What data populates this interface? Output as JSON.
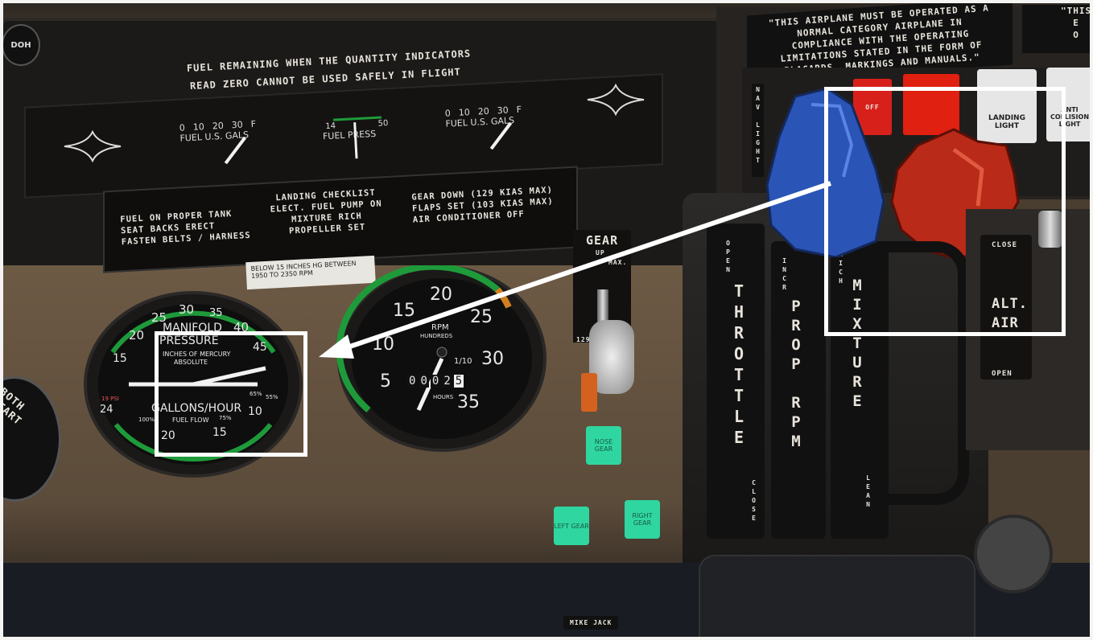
{
  "placard_fuel_remaining": {
    "line1": "FUEL REMAINING WHEN THE QUANTITY INDICATORS",
    "line2": "READ ZERO CANNOT BE USED SAFELY IN FLIGHT"
  },
  "fuel_gauge_left": {
    "label": "FUEL U.S. GALS",
    "ticks": [
      "0",
      "10",
      "20",
      "30",
      "F"
    ]
  },
  "fuel_press_gauge": {
    "label": "FUEL PRESS",
    "ticks": [
      "14",
      "50"
    ]
  },
  "fuel_gauge_right": {
    "label": "FUEL U.S. GALS",
    "ticks": [
      "0",
      "10",
      "20",
      "30",
      "F"
    ]
  },
  "checklist": {
    "col1": [
      "FUEL ON PROPER TANK",
      "SEAT BACKS ERECT",
      "FASTEN BELTS / HARNESS"
    ],
    "col2": [
      "LANDING CHECKLIST",
      "ELECT. FUEL PUMP ON",
      "MIXTURE RICH",
      "PROPELLER SET"
    ],
    "col3": [
      "GEAR DOWN (129 KIAS MAX)",
      "FLAPS SET (103 KIAS MAX)",
      "AIR CONDITIONER OFF"
    ]
  },
  "operating_placard": {
    "lines": [
      "\"THIS AIRPLANE MUST BE OPERATED AS A",
      "NORMAL CATEGORY AIRPLANE IN",
      "COMPLIANCE WITH THE OPERATING",
      "LIMITATIONS STATED IN THE FORM OF",
      "PLACARDS, MARKINGS AND MANUALS.\""
    ],
    "partial_lines": [
      "\"THIS",
      "E",
      "O"
    ]
  },
  "rpm_placard": {
    "line1": "BELOW 15 INCHES HG BETWEEN",
    "line2": "1950 TO 2350 RPM"
  },
  "manifold_gauge": {
    "title1": "MANIFOLD",
    "title2": "PRESSURE",
    "sub1": "INCHES OF MERCURY",
    "sub2": "ABSOLUTE",
    "bottom1": "GALLONS/HOUR",
    "bottom2": "FUEL FLOW",
    "scale_top": [
      "15",
      "20",
      "25",
      "30",
      "35",
      "40",
      "45"
    ],
    "scale_bottom": [
      "24",
      "20",
      "15",
      "10"
    ],
    "pct_labels": [
      "65%",
      "55%",
      "75%",
      "100%"
    ],
    "psi": "19 PSI"
  },
  "rpm_gauge": {
    "title": "RPM",
    "sub": "HUNDREDS",
    "scale": [
      "5",
      "10",
      "15",
      "20",
      "25",
      "30",
      "35"
    ],
    "hobbs": [
      "0",
      "0",
      "0",
      "2",
      "5"
    ],
    "hobbs_unit": "1/10",
    "hours": "HOURS"
  },
  "gear_panel": {
    "title": "GEAR",
    "up": "UP",
    "max_partial": "MAX.",
    "down_speed": "129",
    "nose_light": "NOSE GEAR",
    "left_light": "LEFT GEAR",
    "right_light": "RIGHT GEAR"
  },
  "both_start": "BOTH START",
  "left_knob": "DOH",
  "switches": {
    "nav": "NAV LIGHT",
    "off": "OFF",
    "landing": "LANDING LIGHT",
    "anti": "ANTI COLLISION LIGHT"
  },
  "throttle_quadrant": {
    "throttle": "THROTTLE",
    "throttle_open": "OPEN",
    "throttle_close": "CLOSE",
    "prop": "PROP RPM",
    "prop_incr": "INCR",
    "mixture": "MIXTURE",
    "mixture_rich": "RICH",
    "mixture_lean": "LEAN"
  },
  "alt_air": {
    "close": "CLOSE",
    "label1": "ALT.",
    "label2": "AIR",
    "open": "OPEN"
  },
  "mike_jack": "MIKE JACK",
  "colors": {
    "callout": "#ffffff",
    "knob_blue": "#2850b0",
    "knob_red": "#b82818",
    "gear_light": "#2fd6a0",
    "arc_green": "#1f9a3a"
  }
}
